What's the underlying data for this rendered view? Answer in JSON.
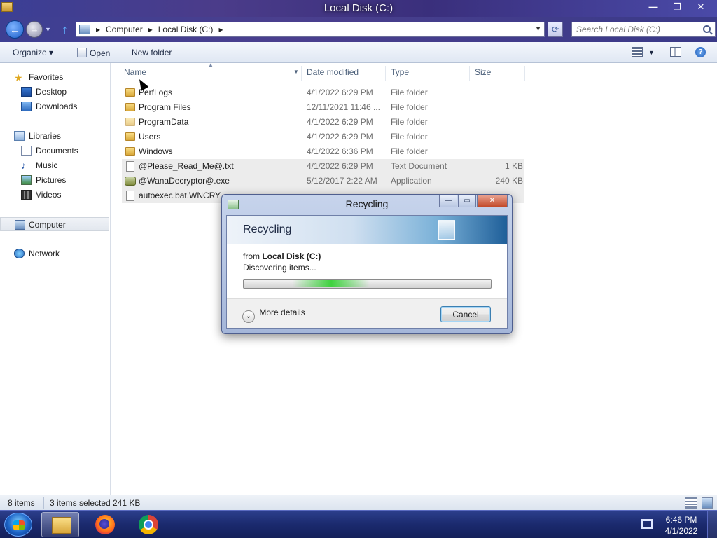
{
  "window": {
    "title": "Local Disk (C:)",
    "minimize": "—",
    "maximize": "❐",
    "close": "✕"
  },
  "address_bar": {
    "crumbs": [
      "Computer",
      "Local Disk (C:)"
    ],
    "separator": "▸",
    "search_placeholder": "Search Local Disk (C:)"
  },
  "command_bar": {
    "organize": "Organize ▾",
    "open": "Open",
    "new_folder": "New folder"
  },
  "nav_pane": {
    "favorites": "Favorites",
    "desktop": "Desktop",
    "downloads": "Downloads",
    "libraries": "Libraries",
    "documents": "Documents",
    "music": "Music",
    "pictures": "Pictures",
    "videos": "Videos",
    "computer": "Computer",
    "network": "Network"
  },
  "columns": {
    "name": "Name",
    "date_modified": "Date modified",
    "type": "Type",
    "size": "Size"
  },
  "files": [
    {
      "name": "PerfLogs",
      "date": "4/1/2022 6:29 PM",
      "type": "File folder",
      "size": "",
      "icon": "folder-icon",
      "selected": false
    },
    {
      "name": "Program Files",
      "date": "12/11/2021 11:46 ...",
      "type": "File folder",
      "size": "",
      "icon": "folder-icon",
      "selected": false
    },
    {
      "name": "ProgramData",
      "date": "4/1/2022 6:29 PM",
      "type": "File folder",
      "size": "",
      "icon": "folder-icon",
      "selected": false
    },
    {
      "name": "Users",
      "date": "4/1/2022 6:29 PM",
      "type": "File folder",
      "size": "",
      "icon": "folder-icon",
      "selected": false
    },
    {
      "name": "Windows",
      "date": "4/1/2022 6:36 PM",
      "type": "File folder",
      "size": "",
      "icon": "folder-icon",
      "selected": false
    },
    {
      "name": "@Please_Read_Me@.txt",
      "date": "4/1/2022 6:29 PM",
      "type": "Text Document",
      "size": "1 KB",
      "icon": "text-file-icon",
      "selected": true
    },
    {
      "name": "@WanaDecryptor@.exe",
      "date": "5/12/2017 2:22 AM",
      "type": "Application",
      "size": "240 KB",
      "icon": "application-icon",
      "selected": true
    },
    {
      "name": "autoexec.bat.WNCRY",
      "date": "",
      "type": "",
      "size": "",
      "icon": "file-icon",
      "selected": true
    }
  ],
  "status_bar": {
    "item_count": "8 items",
    "selection": "3 items selected",
    "selection_size": "241 KB"
  },
  "dialog": {
    "title": "Recycling",
    "heading": "Recycling",
    "from_prefix": "from",
    "from_location": "Local Disk (C:)",
    "status": "Discovering items...",
    "more_details": "More details",
    "cancel": "Cancel",
    "progress_indeterminate": true
  },
  "taskbar": {
    "time": "6:46 PM",
    "date": "4/1/2022",
    "apps": [
      "explorer",
      "firefox",
      "chrome"
    ]
  },
  "colors": {
    "titlebar": "#3b3f95",
    "selection_row": "#ececec",
    "taskbar": "#1b2a6e",
    "dialog_frame": "#a4b6d9",
    "progress_glow": "#3ed23e"
  }
}
